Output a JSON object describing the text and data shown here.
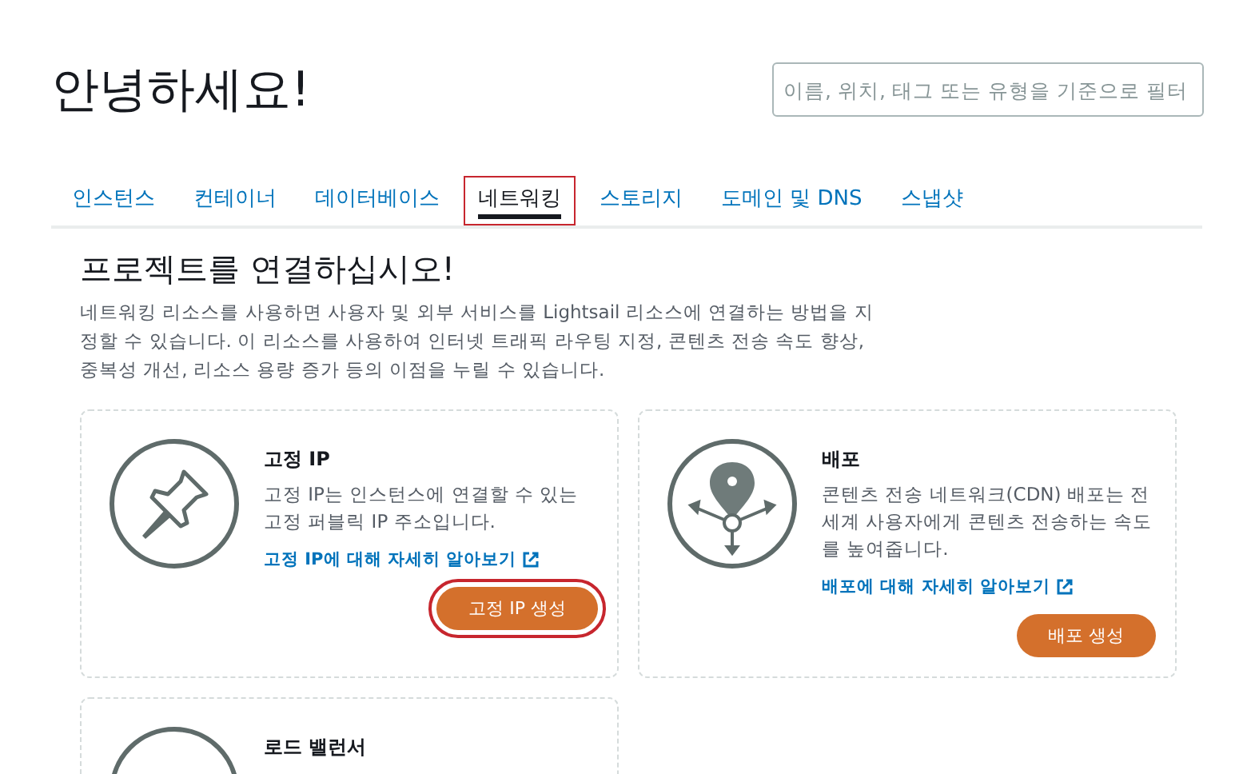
{
  "header": {
    "title": "안녕하세요!"
  },
  "search": {
    "placeholder": "이름, 위치, 태그 또는 유형을 기준으로 필터"
  },
  "tabs": [
    {
      "label": "인스턴스",
      "selected": false,
      "highlighted": false
    },
    {
      "label": "컨테이너",
      "selected": false,
      "highlighted": false
    },
    {
      "label": "데이터베이스",
      "selected": false,
      "highlighted": false
    },
    {
      "label": "네트워킹",
      "selected": true,
      "highlighted": true
    },
    {
      "label": "스토리지",
      "selected": false,
      "highlighted": false
    },
    {
      "label": "도메인 및 DNS",
      "selected": false,
      "highlighted": false
    },
    {
      "label": "스냅샷",
      "selected": false,
      "highlighted": false
    }
  ],
  "section": {
    "title": "프로젝트를 연결하십시오!",
    "description": "네트워킹 리소스를 사용하면 사용자 및 외부 서비스를 Lightsail 리소스에 연결하는 방법을 지정할 수 있습니다. 이 리소스를 사용하여 인터넷 트래픽 라우팅 지정, 콘텐츠 전송 속도 향상, 중복성 개선, 리소스 용량 증가 등의 이점을 누릴 수 있습니다."
  },
  "cards": [
    {
      "kind": "pin",
      "title": "고정 IP",
      "description": "고정 IP는 인스턴스에 연결할 수 있는 고정 퍼블릭 IP 주소입니다.",
      "link": "고정 IP에 대해 자세히 알아보기",
      "button": "고정 IP 생성",
      "highlighted": true
    },
    {
      "kind": "distribution",
      "title": "배포",
      "description": "콘텐츠 전송 네트워크(CDN) 배포는 전 세계 사용자에게 콘텐츠 전송하는 속도를 높여줍니다.",
      "link": "배포에 대해 자세히 알아보기",
      "button": "배포 생성",
      "highlighted": false
    },
    {
      "kind": "balancer",
      "title": "로드 밸런서"
    }
  ]
}
